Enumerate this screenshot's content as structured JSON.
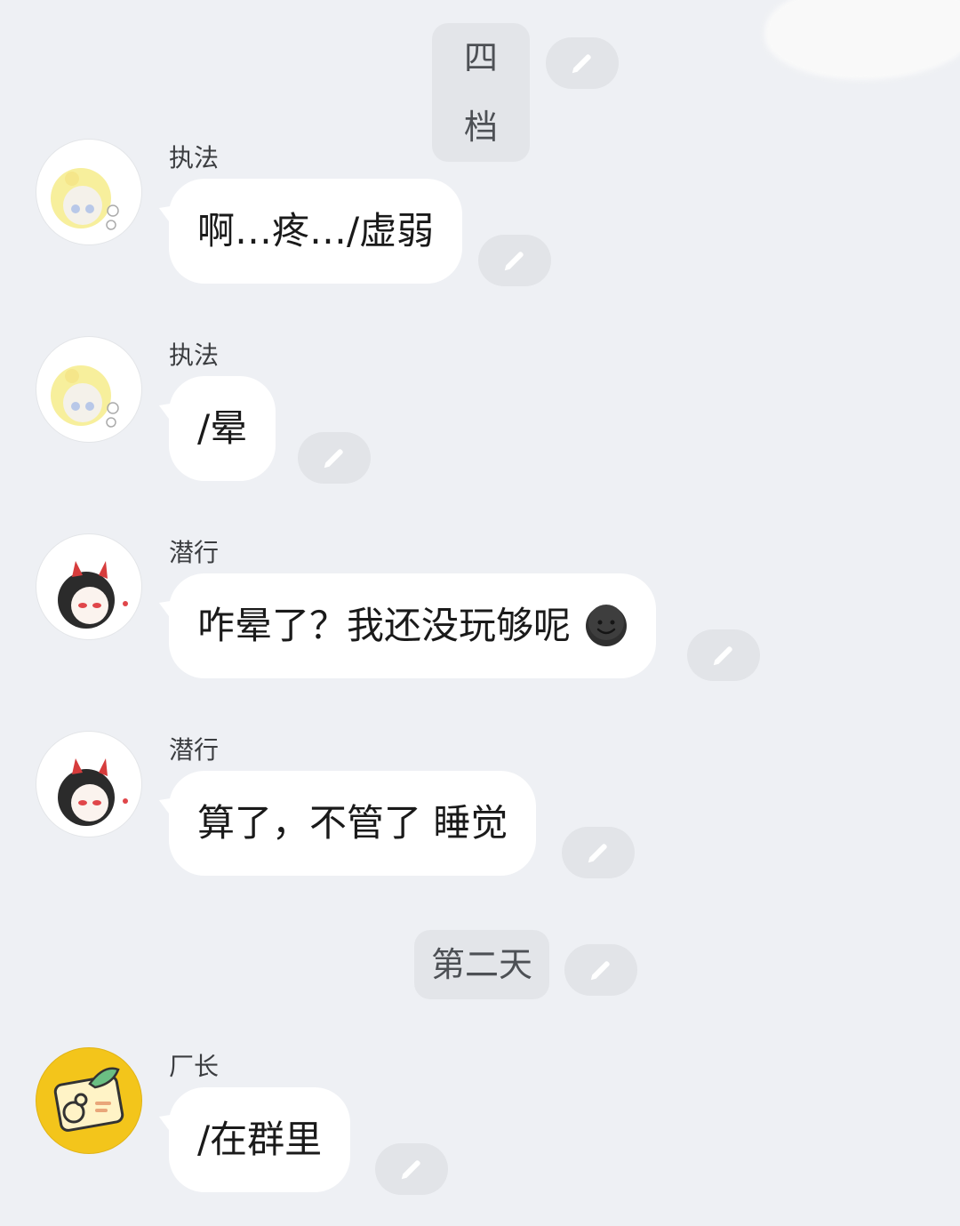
{
  "dividers": {
    "first": "四档",
    "second": "第二天"
  },
  "messages": [
    {
      "sender": "执法",
      "text": "啊…疼…/虚弱",
      "avatar_icon": "yellow-hair-chibi-avatar"
    },
    {
      "sender": "执法",
      "text": "/晕",
      "avatar_icon": "yellow-hair-chibi-avatar"
    },
    {
      "sender": "潜行",
      "text": "咋晕了？我还没玩够呢",
      "avatar_icon": "devil-horn-chibi-avatar",
      "trailing_icon": "dark-smiley-emoji-icon"
    },
    {
      "sender": "潜行",
      "text": "算了，不管了 睡觉",
      "avatar_icon": "devil-horn-chibi-avatar"
    },
    {
      "sender": "厂长",
      "text": "/在群里",
      "avatar_icon": "gourd-badge-avatar"
    }
  ],
  "edit_icon": "pencil-icon",
  "colors": {
    "background": "#eef0f4",
    "bubble": "#ffffff",
    "chip": "#e3e5e9",
    "edit_pill": "#e2e4e8",
    "pencil": "#ffffff",
    "badge_yellow": "#f3c51b"
  }
}
